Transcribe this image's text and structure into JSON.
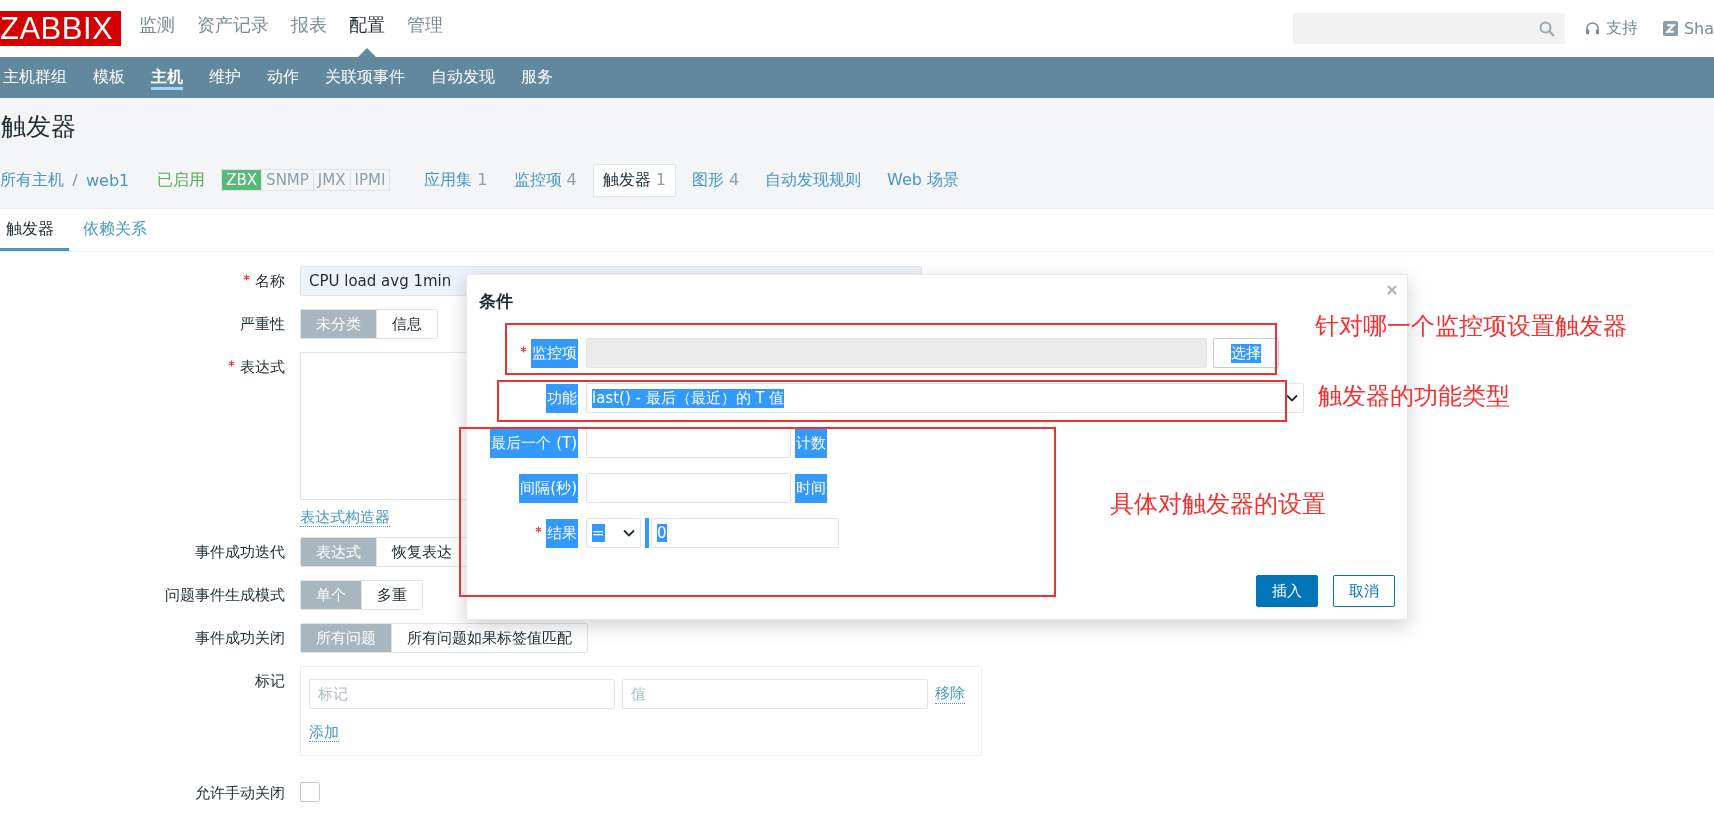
{
  "header": {
    "logo": "ZABBIX",
    "menu": [
      {
        "label": "监测",
        "selected": false
      },
      {
        "label": "资产记录",
        "selected": false
      },
      {
        "label": "报表",
        "selected": false
      },
      {
        "label": "配置",
        "selected": true
      },
      {
        "label": "管理",
        "selected": false
      }
    ],
    "links": [
      {
        "label": "支持",
        "kind": "support"
      },
      {
        "label": "Sha",
        "kind": "share"
      }
    ]
  },
  "subnav": [
    {
      "label": "主机群组",
      "selected": false
    },
    {
      "label": "模板",
      "selected": false
    },
    {
      "label": "主机",
      "selected": true
    },
    {
      "label": "维护",
      "selected": false
    },
    {
      "label": "动作",
      "selected": false
    },
    {
      "label": "关联项事件",
      "selected": false
    },
    {
      "label": "自动发现",
      "selected": false
    },
    {
      "label": "服务",
      "selected": false
    }
  ],
  "page_title": "触发器",
  "host_bar": {
    "breadcrumb": [
      "所有主机",
      "web1"
    ],
    "status": "已启用",
    "availability": [
      {
        "label": "ZBX",
        "on": true
      },
      {
        "label": "SNMP",
        "on": false
      },
      {
        "label": "JMX",
        "on": false
      },
      {
        "label": "IPMI",
        "on": false
      }
    ],
    "tabs": [
      {
        "label": "应用集",
        "count": "1",
        "selected": false
      },
      {
        "label": "监控项",
        "count": "4",
        "selected": false
      },
      {
        "label": "触发器",
        "count": "1",
        "selected": true
      },
      {
        "label": "图形",
        "count": "4",
        "selected": false
      },
      {
        "label": "自动发现规则",
        "selected": false
      },
      {
        "label": "Web 场景",
        "selected": false
      }
    ]
  },
  "form_tabs": [
    {
      "label": "触发器",
      "selected": true
    },
    {
      "label": "依赖关系",
      "selected": false
    }
  ],
  "form": [
    {
      "kind": "text",
      "label": "名称",
      "required": true,
      "value": "CPU load avg 1min"
    },
    {
      "kind": "segmented",
      "label": "严重性",
      "options": [
        {
          "label": "未分类",
          "selected": true
        },
        {
          "label": "信息",
          "selected": false
        }
      ]
    },
    {
      "kind": "textarea",
      "label": "表达式",
      "required": true,
      "link": "表达式构造器"
    },
    {
      "kind": "segmented",
      "label": "事件成功迭代",
      "options": [
        {
          "label": "表达式",
          "selected": true
        },
        {
          "label": "恢复表达",
          "selected": false
        }
      ]
    },
    {
      "kind": "segmented",
      "label": "问题事件生成模式",
      "options": [
        {
          "label": "单个",
          "selected": true
        },
        {
          "label": "多重",
          "selected": false
        }
      ]
    },
    {
      "kind": "segmented",
      "label": "事件成功关闭",
      "options": [
        {
          "label": "所有问题",
          "selected": true
        },
        {
          "label": "所有问题如果标签值匹配",
          "selected": false
        }
      ]
    },
    {
      "kind": "tags",
      "label": "标记",
      "tag_placeholder": "标记",
      "value_placeholder": "值",
      "remove": "移除",
      "add": "添加"
    },
    {
      "kind": "checkbox",
      "label": "允许手动关闭",
      "checked": false
    }
  ],
  "dialog": {
    "title": "条件",
    "fields": [
      {
        "kind": "item",
        "label": "监控项",
        "required": true,
        "highlighted": true,
        "button": "选择"
      },
      {
        "kind": "select",
        "label": "功能",
        "highlighted": true,
        "value": "last() - 最后（最近）的 T 值"
      },
      {
        "kind": "input",
        "label": "最后一个 (T)",
        "highlighted": true,
        "unit": "计数"
      },
      {
        "kind": "input",
        "label": "间隔(秒)",
        "highlighted": true,
        "unit": "时间"
      },
      {
        "kind": "result",
        "label": "结果",
        "required": true,
        "highlighted": true,
        "operator": "=",
        "value": "0"
      }
    ],
    "buttons": [
      {
        "label": "插入",
        "kind": "primary"
      },
      {
        "label": "取消",
        "kind": "secondary"
      }
    ]
  },
  "annotations": [
    "针对哪一个监控项设置触发器",
    "触发器的功能类型",
    "具体对触发器的设置"
  ]
}
